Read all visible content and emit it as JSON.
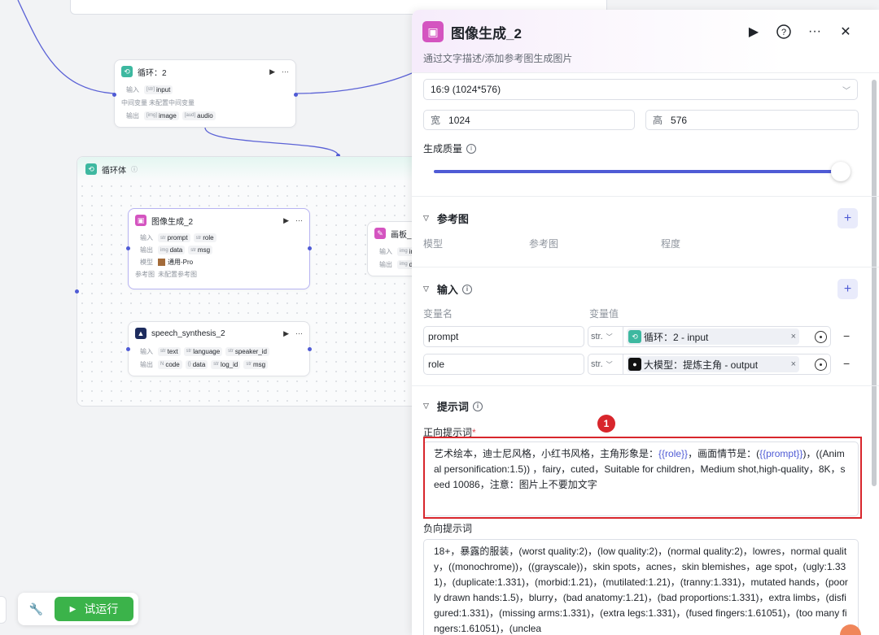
{
  "canvas": {
    "loop_node": {
      "title": "循环：2",
      "input_label": "输入",
      "input_chip": "input",
      "mid_label": "中间变量",
      "mid_value": "未配置中间变量",
      "output_label": "输出",
      "output_chips": [
        "image",
        "audio"
      ]
    },
    "group": {
      "title": "循环体"
    },
    "image_node": {
      "title": "图像生成_2",
      "input_label": "输入",
      "input_chips": [
        "prompt",
        "role"
      ],
      "output_label": "输出",
      "output_chips": [
        "data",
        "msg"
      ],
      "model_label": "模型",
      "model_value": "通用-Pro",
      "ref_label": "参考图",
      "ref_value": "未配置参考图"
    },
    "canvas_node": {
      "title": "画板_",
      "input_label": "输入",
      "input_chip": "ima",
      "output_label": "输出",
      "output_chip": "da"
    },
    "speech_node": {
      "title": "speech_synthesis_2",
      "input_label": "输入",
      "input_chips": [
        "text",
        "language",
        "speaker_id"
      ],
      "output_label": "输出",
      "output_chips": [
        "code",
        "data",
        "log_id",
        "msg"
      ]
    }
  },
  "toolbar": {
    "run_label": "试运行"
  },
  "panel": {
    "title": "图像生成_2",
    "description": "通过文字描述/添加参考图生成图片",
    "ratio": "16:9 (1024*576)",
    "width_label": "宽",
    "width_value": "1024",
    "height_label": "高",
    "height_value": "576",
    "quality_label": "生成质量",
    "quality_level": 0.98,
    "ref_section": {
      "title": "参考图",
      "columns": [
        "模型",
        "参考图",
        "程度"
      ]
    },
    "input_section": {
      "title": "输入",
      "col_name": "变量名",
      "col_value": "变量值",
      "rows": [
        {
          "name": "prompt",
          "type": "str.",
          "ref": "循环：2 - input"
        },
        {
          "name": "role",
          "type": "str.",
          "ref": "大模型：提炼主角 - output"
        }
      ]
    },
    "prompt_section": {
      "title": "提示词",
      "positive_label": "正向提示词",
      "required_mark": "*",
      "positive_prefix": "艺术绘本，迪士尼风格，小红书风格，主角形象是：",
      "positive_var1": "{{role}}",
      "positive_mid": "，画面情节是：(",
      "positive_var2": "{{prompt}}",
      "positive_suffix": ")，((Animal personification:1.5)) ，fairy，cuted，Suitable for children，Medium shot,high-quality，8K，seed 10086，注意：图片上不要加文字",
      "negative_label": "负向提示词",
      "negative_text": "18+，暴露的服装，(worst quality:2)，(low quality:2)，(normal quality:2)，lowres，normal quality，((monochrome))，((grayscale))，skin spots，acnes，skin blemishes，age spot，(ugly:1.331)，(duplicate:1.331)，(morbid:1.21)，(mutilated:1.21)，(tranny:1.331)，mutated hands，(poorly drawn hands:1.5)，blurry，(bad anatomy:1.21)，(bad proportions:1.331)，extra limbs，(disfigured:1.331)，(missing arms:1.331)，(extra legs:1.331)，(fused fingers:1.61051)，(too many fingers:1.61051)，(unclea"
    },
    "annotation_badge": "1"
  }
}
